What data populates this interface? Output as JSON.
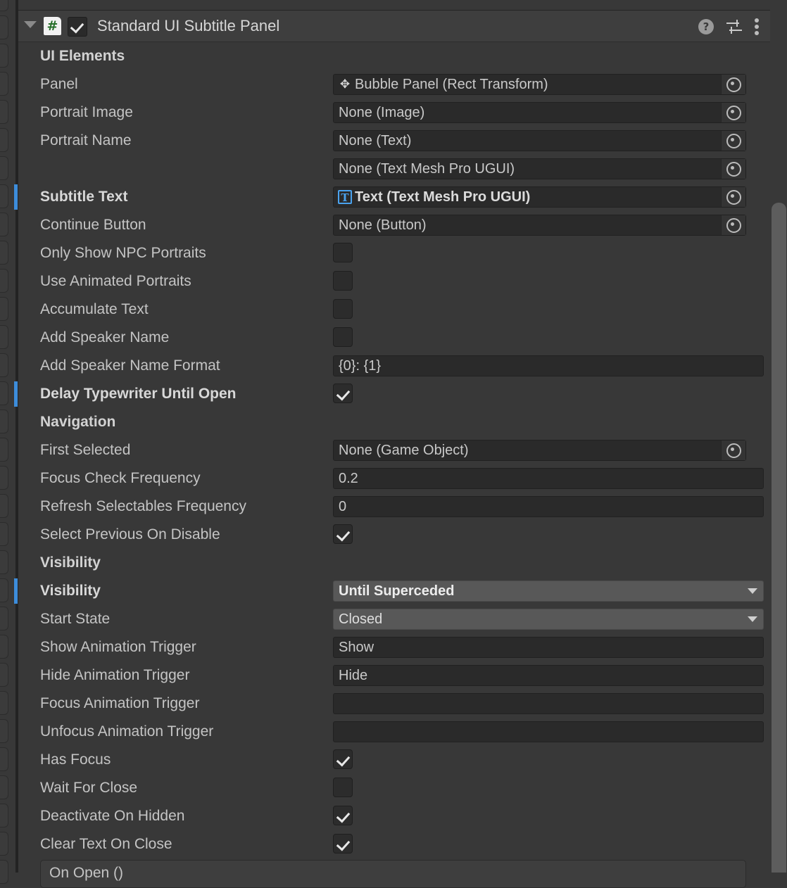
{
  "window": {
    "component_title": "Standard UI Subtitle Panel",
    "script_icon": "csharp-script-icon",
    "enabled": true,
    "foldout_expanded": true,
    "header_icons": [
      "help-icon",
      "preset-icon",
      "kebab-menu-icon"
    ],
    "accent_override_color": "#3d8ddb",
    "dropdown_bg_color": "#585858",
    "panel_bg_color": "#383838"
  },
  "rows": [
    {
      "label": "UI Elements",
      "type": "section"
    },
    {
      "label": "Panel",
      "type": "object",
      "value": "Bubble Panel (Rect Transform)",
      "icon": "rect-transform-icon"
    },
    {
      "label": "Portrait Image",
      "type": "object",
      "value": "None (Image)",
      "icon": "none"
    },
    {
      "label": "Portrait Name",
      "type": "object",
      "value": "None (Text)",
      "icon": "none"
    },
    {
      "label": "",
      "type": "object",
      "value": "None (Text Mesh Pro UGUI)",
      "icon": "none"
    },
    {
      "label": "Subtitle Text",
      "type": "object",
      "value": "Text (Text Mesh Pro UGUI)",
      "icon": "text-mesh-pro-icon",
      "bold": true,
      "overridden": true
    },
    {
      "label": "Continue Button",
      "type": "object",
      "value": "None (Button)",
      "icon": "none"
    },
    {
      "label": "Only Show NPC Portraits",
      "type": "checkbox",
      "checked": false
    },
    {
      "label": "Use Animated Portraits",
      "type": "checkbox",
      "checked": false
    },
    {
      "label": "Accumulate Text",
      "type": "checkbox",
      "checked": false
    },
    {
      "label": "Add Speaker Name",
      "type": "checkbox",
      "checked": false
    },
    {
      "label": "Add Speaker Name Format",
      "type": "text",
      "value": "{0}: {1}"
    },
    {
      "label": "Delay Typewriter Until Open",
      "type": "checkbox",
      "checked": true,
      "bold": true,
      "overridden": true
    },
    {
      "label": "Navigation",
      "type": "section"
    },
    {
      "label": "First Selected",
      "type": "object",
      "value": "None (Game Object)",
      "icon": "none"
    },
    {
      "label": "Focus Check Frequency",
      "type": "text",
      "value": "0.2"
    },
    {
      "label": "Refresh Selectables Frequency",
      "type": "text",
      "value": "0"
    },
    {
      "label": "Select Previous On Disable",
      "type": "checkbox",
      "checked": true
    },
    {
      "label": "Visibility",
      "type": "section"
    },
    {
      "label": "Visibility",
      "type": "dropdown",
      "value": "Until Superceded",
      "bold": true,
      "overridden": true
    },
    {
      "label": "Start State",
      "type": "dropdown",
      "value": "Closed"
    },
    {
      "label": "Show Animation Trigger",
      "type": "text",
      "value": "Show"
    },
    {
      "label": "Hide Animation Trigger",
      "type": "text",
      "value": "Hide"
    },
    {
      "label": "Focus Animation Trigger",
      "type": "text",
      "value": ""
    },
    {
      "label": "Unfocus Animation Trigger",
      "type": "text",
      "value": ""
    },
    {
      "label": "Has Focus",
      "type": "checkbox",
      "checked": true
    },
    {
      "label": "Wait For Close",
      "type": "checkbox",
      "checked": false
    },
    {
      "label": "Deactivate On Hidden",
      "type": "checkbox",
      "checked": true
    },
    {
      "label": "Clear Text On Close",
      "type": "checkbox",
      "checked": true
    }
  ],
  "event_box": {
    "title": "On Open ()"
  },
  "scrollbar": {
    "name": "vertical-scrollbar"
  }
}
